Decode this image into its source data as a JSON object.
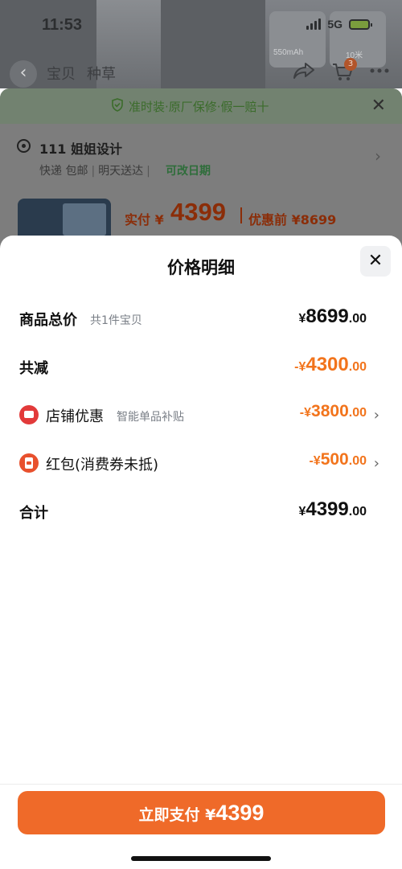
{
  "status_bar": {
    "time": "11:53",
    "network": "5G"
  },
  "background_page": {
    "nav_tabs": [
      "宝贝",
      "种草"
    ],
    "card_texts": [
      "550mAh",
      "10米"
    ],
    "cart_badge": "3"
  },
  "order_summary": {
    "banner": "准时装·原厂保修·假一赔十",
    "address_name": "111 姐姐设计",
    "delivery": [
      "快递 包邮",
      "明天送达"
    ],
    "change_date": "可改日期",
    "pay_label": "实付 ¥",
    "pay_amount": "4399",
    "price_before": "优惠前 ¥8699"
  },
  "price_detail": {
    "title": "价格明细",
    "rows": [
      {
        "label": "商品总价",
        "sub": "共1件宝贝",
        "amount_symbol": "¥",
        "amount_int": "8699",
        "amount_dec": ".00"
      },
      {
        "label": "共减",
        "sub": "",
        "amount_symbol": "-¥",
        "amount_int": "4300",
        "amount_dec": ".00"
      },
      {
        "label": "店铺优惠",
        "sub": "智能单品补贴",
        "amount_symbol": "-¥",
        "amount_int": "3800",
        "amount_dec": ".00"
      },
      {
        "label": "红包(消费券未抵)",
        "sub": "",
        "amount_symbol": "-¥",
        "amount_int": "500",
        "amount_dec": ".00"
      },
      {
        "label": "合计",
        "sub": "",
        "amount_symbol": "¥",
        "amount_int": "4399",
        "amount_dec": ".00"
      }
    ]
  },
  "pay_button": {
    "label": "立即支付 ¥",
    "amount": "4399"
  },
  "colors": {
    "accent_orange": "#ef6a29",
    "discount_orange": "#f2741c",
    "shop_icon_red": "#e23a3a"
  }
}
